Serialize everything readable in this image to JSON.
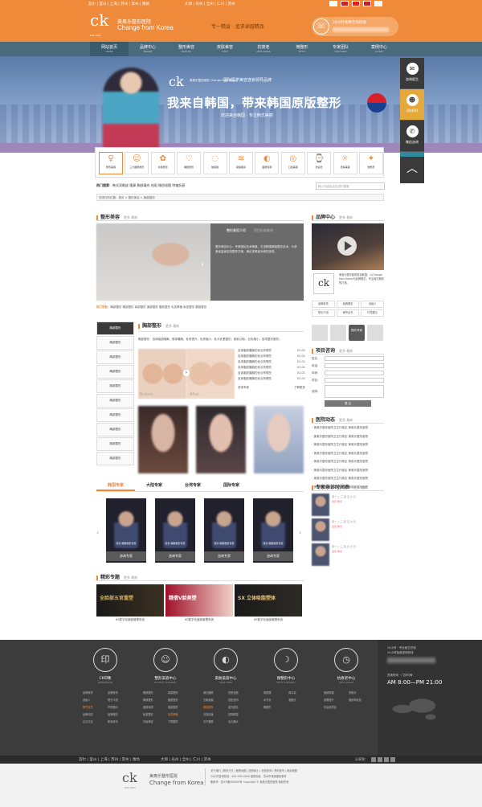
{
  "topbar": {
    "cities_a": "首尔 | 釜山 | 上海 | 苏州 | 常州 | 潍坊",
    "cities_b": "大邱 | 光州 | 全州 | 仁川 | 济州",
    "flags": [
      "KR",
      "CN",
      "CH",
      "TW",
      "JP"
    ]
  },
  "header": {
    "logo_mark": "ck",
    "logo_year": "EST.1987",
    "logo_cn": "美奥乐整形医院",
    "logo_en": "Change from Korea",
    "slogan": "专一精益 · 追求卓越精品",
    "hotline_label": "24小时免费咨询热线"
  },
  "nav": [
    {
      "label": "网站首页",
      "sub": "HOME"
    },
    {
      "label": "品牌中心",
      "sub": "BRAND"
    },
    {
      "label": "整形美容",
      "sub": "PLASTIC"
    },
    {
      "label": "皮肤美容",
      "sub": "SKIN"
    },
    {
      "label": "抗衰老",
      "sub": "ANTI-AGING"
    },
    {
      "label": "微整形",
      "sub": "PETIT"
    },
    {
      "label": "专家团队",
      "sub": "DOCTORS"
    },
    {
      "label": "案例中心",
      "sub": "CASES"
    }
  ],
  "banner": {
    "logo_mark": "ck",
    "logo_text": "美奥乐整形医院 Change from Korea",
    "tag": "国际医学美容连锁领导品牌",
    "headline": "我来自韩国，带来韩国原版整形",
    "subline": "欢迎来自韩国 · 专注韩式美丽"
  },
  "float_bar": [
    {
      "label": "咨询医生",
      "icon": "chat-icon"
    },
    {
      "label": "添加QQ",
      "icon": "qq-icon"
    },
    {
      "label": "微信咨询",
      "icon": "wechat-icon"
    },
    {
      "label": "医院地图",
      "icon": "map-pin-icon"
    }
  ],
  "service_icons": [
    "整形美容",
    "三大眼部整形",
    "鼻部整形",
    "胸部整形",
    "玻尿酸",
    "吸脂瘦身",
    "面部轮廓",
    "口腔美容",
    "抗衰老",
    "皮肤美容",
    "微整形"
  ],
  "hot": {
    "label": "热门搜索：",
    "items": "韩式双眼皮  隆鼻  胸部填充  祛斑  微创吸脂  除皱抗衰"
  },
  "search": {
    "placeholder": "输入内容后点击进行搜索"
  },
  "breadcrumb": "您现在的位置：首页 > 整形美容 > 胸部整形",
  "plastic": {
    "title": "整形美容",
    "more": "更多 最新",
    "panel_tab1": "整形美容介绍",
    "panel_tab2": "项目价格查询",
    "panel_text": "整形美容中心：专家团队技术精湛，引进韩国原版整形技术，为求美者量身定制整形方案，满足求美者对美的追求。",
    "links_label": "热门项目：",
    "links": "胸部整形  眼部整形  鼻部整形  面部整形  脂肪整形  毛发移植  私密整形  唇部整形"
  },
  "side_menu": [
    "胸部整形",
    "胸部整形",
    "胸部整形",
    "胸部整形",
    "胸部整形",
    "胸部整形",
    "胸部整形",
    "胸部整形",
    "胸部整形",
    "胸部整形"
  ],
  "breast": {
    "title": "胸部整形",
    "more": "更多 最新",
    "desc": "胸部整形：自体脂肪隆胸，假体隆胸，乳房提升，乳房缩小，乳头乳晕整形，副乳切除，巨乳缩小，各项整形服务。",
    "before": "Before",
    "after": "After",
    "list": [
      {
        "t": "自体脂肪隆胸的优点有哪些",
        "d": "01-01"
      },
      {
        "t": "自体脂肪隆胸的优点有哪些",
        "d": "01-01"
      },
      {
        "t": "自体脂肪隆胸的优点有哪些",
        "d": "01-01"
      },
      {
        "t": "自体脂肪隆胸的优点有哪些",
        "d": "01-01"
      },
      {
        "t": "自体脂肪隆胸的优点有哪些",
        "d": "01-01"
      },
      {
        "t": "自体脂肪隆胸的优点有哪些",
        "d": "01-01"
      }
    ],
    "btn_consult": "咨询专家",
    "btn_learn": "了解更多"
  },
  "expert_tabs": [
    "韩国专家",
    "大陆专家",
    "台湾专家",
    "国际专家"
  ],
  "doctors": [
    {
      "label": "院长  胸部整形专家",
      "btn": "咨询专家"
    },
    {
      "label": "院长  胸部整形专家",
      "btn": "咨询专家"
    },
    {
      "label": "院长  胸部整形专家",
      "btn": "咨询专家"
    },
    {
      "label": "院长  胸部整形专家",
      "btn": "咨询专家"
    }
  ],
  "special": {
    "title": "精彩专题",
    "more": "更多 最新",
    "items": [
      {
        "cap": "6S数字化面部管理系统",
        "overlay": "全脸部五官重塑"
      },
      {
        "cap": "6S数字化面部管理系统",
        "overlay": "精倩V脸美塑"
      },
      {
        "cap": "6S数字化面部管理系统",
        "overlay": "SX 立体吸脂塑体"
      }
    ]
  },
  "brand": {
    "title": "品牌中心",
    "more": "更多 最新",
    "mini": "ck",
    "text": "美奥乐整形医院源自韩国，以Change from Korea为品牌理念，专注韩式美丽的打造。",
    "grid": [
      [
        "品牌故事",
        "品牌理念",
        "创始人"
      ],
      [
        "院长介绍",
        "荣誉证书",
        "环境展示"
      ]
    ],
    "icons": [
      "预约专家"
    ]
  },
  "consult": {
    "title": "项目咨询",
    "more": "更多 最新",
    "fields": [
      "姓名：",
      "电话：",
      "年龄：",
      "项目：",
      "说明："
    ],
    "submit": "提 交"
  },
  "news": {
    "title": "医院动态",
    "more": "更多 最新",
    "items": [
      "美奥乐整形医院卫生行政定  美奥乐整形医院",
      "美奥乐整形医院卫生行政定  美奥乐整形医院",
      "美奥乐整形医院卫生行政定  美奥乐整形医院",
      "美奥乐整形医院卫生行政定  美奥乐整形医院",
      "美奥乐整形医院卫生行政定  美奥乐整形医院",
      "美奥乐整形医院卫生行政定  美奥乐整形医院",
      "美奥乐整形医院卫生行政定  美奥乐整形医院",
      "美奥乐整形医院卫生行政定  美奥乐整形医院"
    ]
  },
  "schedule": {
    "title": "专家亲诊时间表",
    "more": "更多 最新",
    "rows": [
      {
        "days": "周一 二 三 四 五 六 日",
        "status": "出诊  休诊"
      },
      {
        "days": "周一 二 三 四 五 六 日",
        "status": "出诊  休诊"
      },
      {
        "days": "周一 二 三 四 五 六 日",
        "status": "出诊  休诊"
      }
    ]
  },
  "footer": {
    "cols": [
      {
        "h": "CK印象",
        "h2": "IMPRESSION",
        "icon": "seal-icon",
        "items": [
          "品牌故事",
          "品牌故事",
          "创始人",
          "院长介绍",
          "荣誉证书",
          "环境展示",
          "品牌动态",
          "品牌理念",
          "企业文化",
          "新闻资讯"
        ]
      },
      {
        "h": "整形美容中心",
        "h2": "PLASTIC SURGERY",
        "icon": "face-icon",
        "items": [
          "眼部整形",
          "鼻部整形",
          "胸部整形",
          "脂肪整形",
          "面部轮廓",
          "唇部整形",
          "私密整形",
          "毛发移植",
          "牙齿美容",
          "下颌整形"
        ]
      },
      {
        "h": "皮肤美容中心",
        "h2": "SKIN CARE",
        "icon": "skin-icon",
        "items": [
          "美白嫩肤",
          "祛斑祛痣",
          "去除疤痕",
          "祛痘祛印",
          "紧致提升",
          "激光脱毛",
          "去除纹身",
          "祛除眼袋",
          "光子嫩肤",
          "毛孔粗大"
        ]
      },
      {
        "h": "微整形中心",
        "h2": "PETIT SURGERY",
        "icon": "profile-icon",
        "items": [
          "玻尿酸",
          "肉毒素",
          "水光针",
          "溶脂针",
          "微整形"
        ]
      },
      {
        "h": "抗衰老中心",
        "h2": "ANTI-AGING",
        "icon": "clock-icon",
        "items": [
          "面部除皱",
          "童颜针",
          "线雕提升",
          "面部年轻化",
          "抗衰老项目"
        ]
      }
    ],
    "right_a": "24小时 · 专业医生在线",
    "right_b": "24小时免费咨询热线",
    "right_c": "咨询时间 · 门诊时间",
    "right_d": "AM 8:00—PM 21:00"
  },
  "bottombar": {
    "cities_a": "首尔 | 釜山 | 上海 | 苏州 | 常州 | 潍坊",
    "cities_b": "大邱 | 光州 | 全州 | 仁川 | 济州",
    "share": "分享到："
  },
  "copyright": {
    "logo_mark": "ck",
    "logo_year": "EST.1987",
    "logo_cn": "美奥乐整形医院",
    "logo_en": "Change from Korea",
    "lines": [
      "关于我们 | 联系方式 | 医院地图 | 招贤纳士 | 在线咨询 | 预约挂号 | 网站地图",
      "24小时咨询热线：400-000-0000    医院地址：苏州市某某路某某号",
      "备案号：苏ICP备000000号    Copyright © 美奥乐整形医院 版权所有"
    ]
  }
}
